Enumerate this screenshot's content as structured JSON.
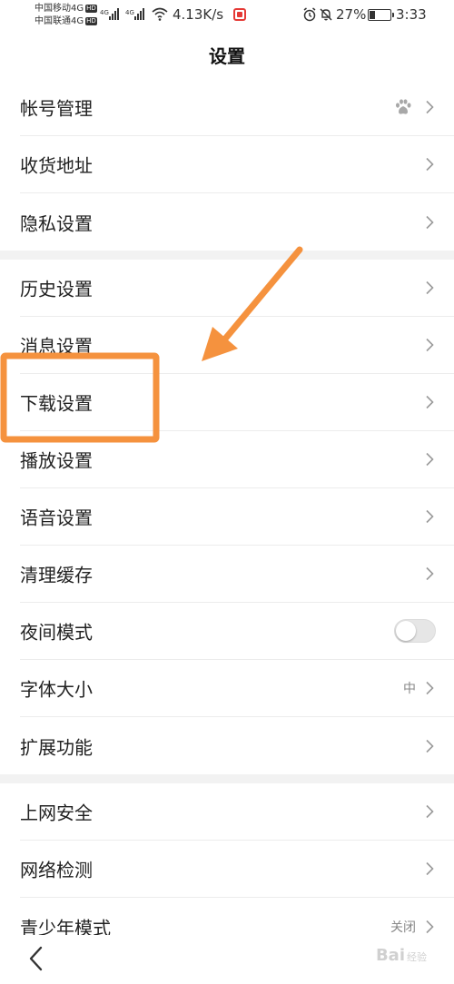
{
  "status": {
    "carrier1": "中国移动4G",
    "carrier2": "中国联通4G",
    "hd": "HD",
    "net1": "4G",
    "net2": "4G",
    "speed": "4.13K/s",
    "battery": "27%",
    "time": "3:33"
  },
  "page": {
    "title": "设置"
  },
  "sections": [
    {
      "items": [
        {
          "label": "帐号管理"
        },
        {
          "label": "收货地址"
        },
        {
          "label": "隐私设置"
        }
      ]
    },
    {
      "items": [
        {
          "label": "历史设置"
        },
        {
          "label": "消息设置"
        },
        {
          "label": "下载设置"
        },
        {
          "label": "播放设置"
        },
        {
          "label": "语音设置"
        },
        {
          "label": "清理缓存"
        },
        {
          "label": "夜间模式",
          "toggle_on": false
        },
        {
          "label": "字体大小",
          "value": "中"
        },
        {
          "label": "扩展功能"
        }
      ]
    },
    {
      "items": [
        {
          "label": "上网安全"
        },
        {
          "label": "网络检测"
        },
        {
          "label": "青少年模式",
          "value": "关闭"
        }
      ]
    }
  ],
  "watermark": {
    "logo": "Bai",
    "suffix": "经验"
  },
  "colors": {
    "annotation": "#f5923e",
    "chevron": "#9a9a9a",
    "divider": "#f2f2f2"
  },
  "icons": {
    "account_badge": "paw-icon",
    "back": "back-arrow-icon",
    "chevron": "chevron-right-icon"
  }
}
